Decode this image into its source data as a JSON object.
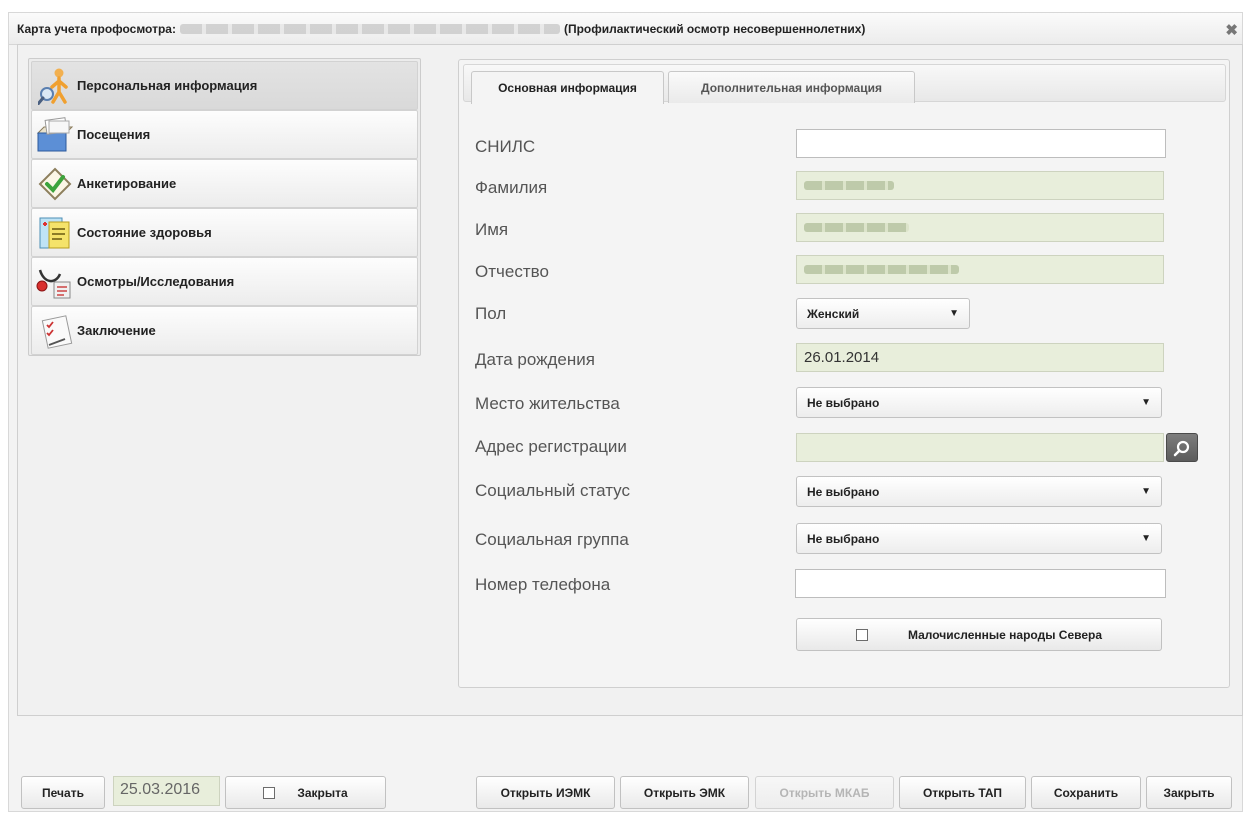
{
  "window": {
    "title_prefix": "Карта учета профосмотра:",
    "title_suffix": "(Профилактический осмотр несовершеннолетних)"
  },
  "sidebar": {
    "items": [
      {
        "label": "Персональная информация",
        "icon": "person-magnifier-icon"
      },
      {
        "label": "Посещения",
        "icon": "card-file-icon"
      },
      {
        "label": "Анкетирование",
        "icon": "checkmark-diamond-icon"
      },
      {
        "label": "Состояние здоровья",
        "icon": "health-chart-icon"
      },
      {
        "label": "Осмотры/Исследования",
        "icon": "stethoscope-icon"
      },
      {
        "label": "Заключение",
        "icon": "conclusion-document-icon"
      }
    ]
  },
  "tabs": {
    "main": "Основная информация",
    "extra": "Дополнительная информация"
  },
  "form": {
    "snils_label": "СНИЛС",
    "snils_value": "",
    "lastname_label": "Фамилия",
    "firstname_label": "Имя",
    "patronymic_label": "Отчество",
    "gender_label": "Пол",
    "gender_value": "Женский",
    "birthdate_label": "Дата рождения",
    "birthdate_value": "26.01.2014",
    "residence_label": "Место жительства",
    "residence_value": "Не выбрано",
    "address_label": "Адрес регистрации",
    "address_value": "",
    "social_status_label": "Социальный статус",
    "social_status_value": "Не выбрано",
    "social_group_label": "Социальная группа",
    "social_group_value": "Не выбрано",
    "phone_label": "Номер телефона",
    "phone_value": "",
    "north_peoples_label": "Малочисленные народы Севера"
  },
  "footer": {
    "print": "Печать",
    "date": "25.03.2016",
    "closed": "Закрыта",
    "open_iemk": "Открыть ИЭМК",
    "open_emk": "Открыть ЭМК",
    "open_mkab": "Открыть МКАБ",
    "open_tap": "Открыть ТАП",
    "save": "Сохранить",
    "close": "Закрыть"
  }
}
